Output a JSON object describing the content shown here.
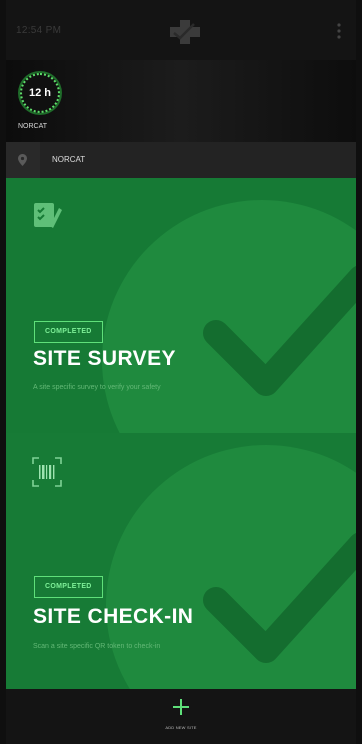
{
  "status_bar": {
    "time": "12:54 PM"
  },
  "hours": {
    "value": "12 h",
    "site": "NORCAT"
  },
  "location": {
    "name": "NORCAT"
  },
  "cards": [
    {
      "status": "COMPLETED",
      "title": "SITE SURVEY",
      "description": "A site specific survey to verify your safety",
      "icon": "clipboard-check-icon"
    },
    {
      "status": "COMPLETED",
      "title": "SITE CHECK-IN",
      "description": "Scan a site specific QR token to check-in",
      "icon": "barcode-scan-icon"
    }
  ],
  "bottom_bar": {
    "add_label": "ADD NEW SITE",
    "add_icon": "plus-icon"
  },
  "colors": {
    "card_green": "#167a35",
    "accent_green": "#5fe07a",
    "dark_bg": "#111111"
  }
}
